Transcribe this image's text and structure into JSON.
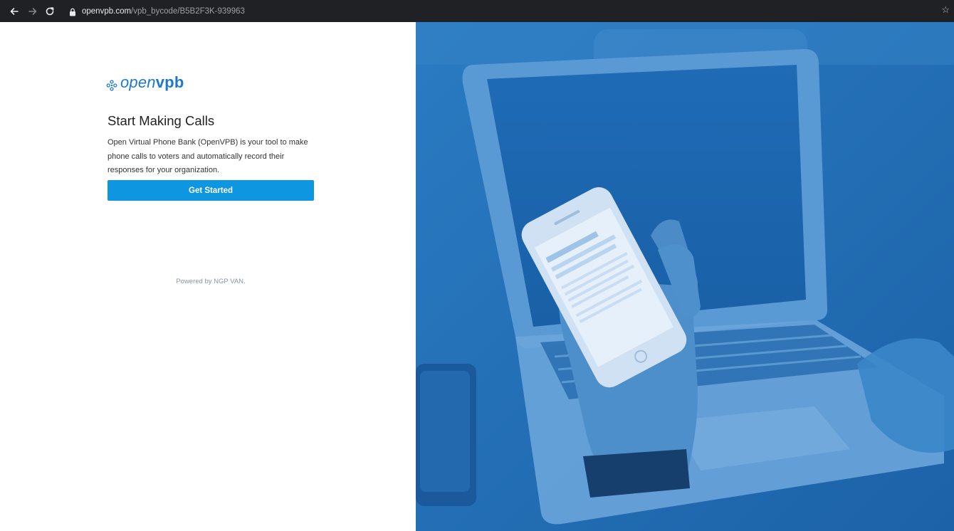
{
  "browser": {
    "url_host": "openvpb.com",
    "url_path": "/vpb_bycode/B5B2F3K-939963",
    "icons": [
      "back-arrow-icon",
      "forward-arrow-icon",
      "reload-icon",
      "lock-icon",
      "star-icon"
    ]
  },
  "brand": {
    "logo_light": "open",
    "logo_bold": "vpb"
  },
  "main": {
    "title": "Start Making Calls",
    "description": "Open Virtual Phone Bank (OpenVPB) is your tool to make phone calls to voters and automatically record their responses for your organization.",
    "cta_label": "Get Started",
    "footer": "Powered by NGP VAN."
  },
  "colors": {
    "toolbar": "#202124",
    "brand": "#1e7ac9",
    "button": "#0f96e0",
    "hero_overlay": "#1e6fb8",
    "annotation": "#e31e24"
  }
}
